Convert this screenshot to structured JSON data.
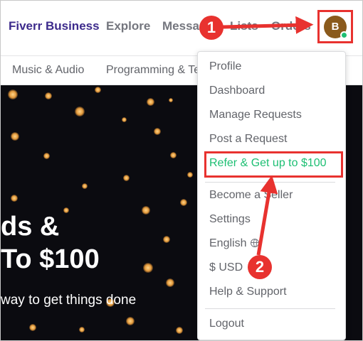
{
  "nav": {
    "brand": "Fiverr Business",
    "explore": "Explore",
    "messages": "Messages",
    "lists": "Lists",
    "orders": "Orders",
    "avatar_initial": "B"
  },
  "categories": [
    "Music & Audio",
    "Programming & Tech"
  ],
  "hero": {
    "line1": "ds &",
    "line2": " To $100",
    "subtitle": "way to get things done"
  },
  "menu": {
    "profile": "Profile",
    "dashboard": "Dashboard",
    "manage_requests": "Manage Requests",
    "post_request": "Post a Request",
    "refer": "Refer & Get up to $100",
    "become_seller": "Become a Seller",
    "settings": "Settings",
    "language": "English",
    "currency": "$ USD",
    "help": "Help & Support",
    "logout": "Logout"
  },
  "annotations": {
    "step1": "1",
    "step2": "2"
  },
  "colors": {
    "brand": "#3d2b8c",
    "accent_green": "#1dbf73",
    "annotation_red": "#e8322f",
    "avatar_bg": "#8a5a1c"
  }
}
